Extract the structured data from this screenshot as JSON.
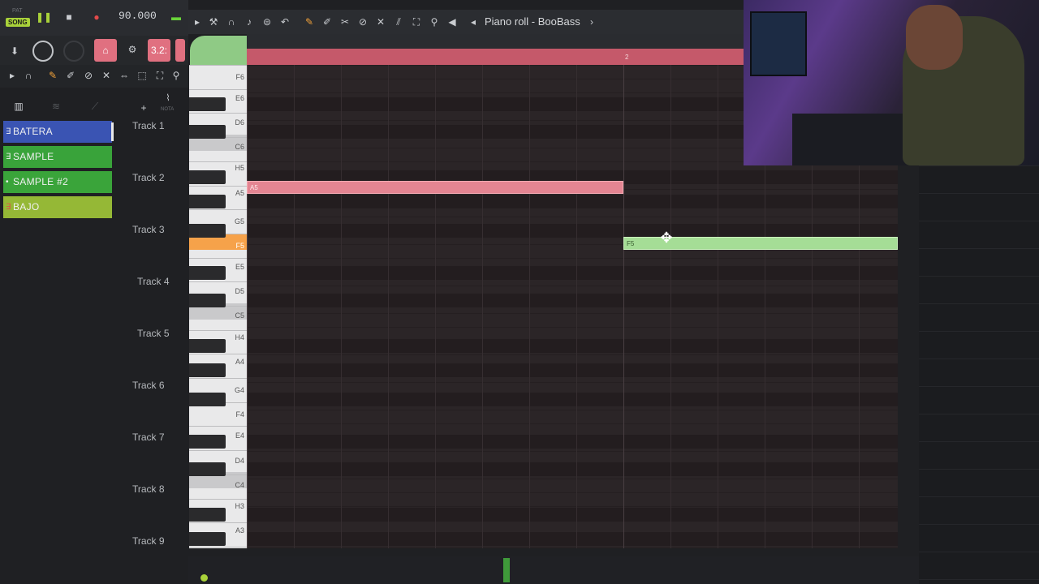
{
  "transport": {
    "pat_label": "PAT",
    "song_label": "SONG",
    "tempo": "90.000",
    "snap_value": "3.2:"
  },
  "piano_roll": {
    "title": "Piano roll - BooBass",
    "ruler_bar_marker": "2",
    "key_labels": [
      "F6",
      "E6",
      "D6",
      "C6",
      "H5",
      "A5",
      "G5",
      "F5",
      "E5",
      "D5",
      "C5",
      "H4",
      "A4",
      "G4",
      "F4",
      "E4",
      "D4",
      "C4",
      "H3",
      "A3"
    ],
    "highlighted_key": "F5",
    "notes": [
      {
        "label": "A5",
        "color": "#e48592"
      },
      {
        "label": "F5",
        "color": "#a5dd96"
      }
    ]
  },
  "channel_rack": {
    "nota_label": "NOTA",
    "channels": [
      {
        "name": "BATERA",
        "color": "#3a54b3"
      },
      {
        "name": "SAMPLE",
        "color": "#39a33a"
      },
      {
        "name": "SAMPLE #2",
        "color": "#3aa43a"
      },
      {
        "name": "BAJO",
        "color": "#95b836"
      }
    ]
  },
  "playlist": {
    "tracks": [
      "Track 1",
      "Track 2",
      "Track 3",
      "Track 4",
      "Track 5",
      "Track 6",
      "Track 7",
      "Track 8",
      "Track 9"
    ]
  }
}
